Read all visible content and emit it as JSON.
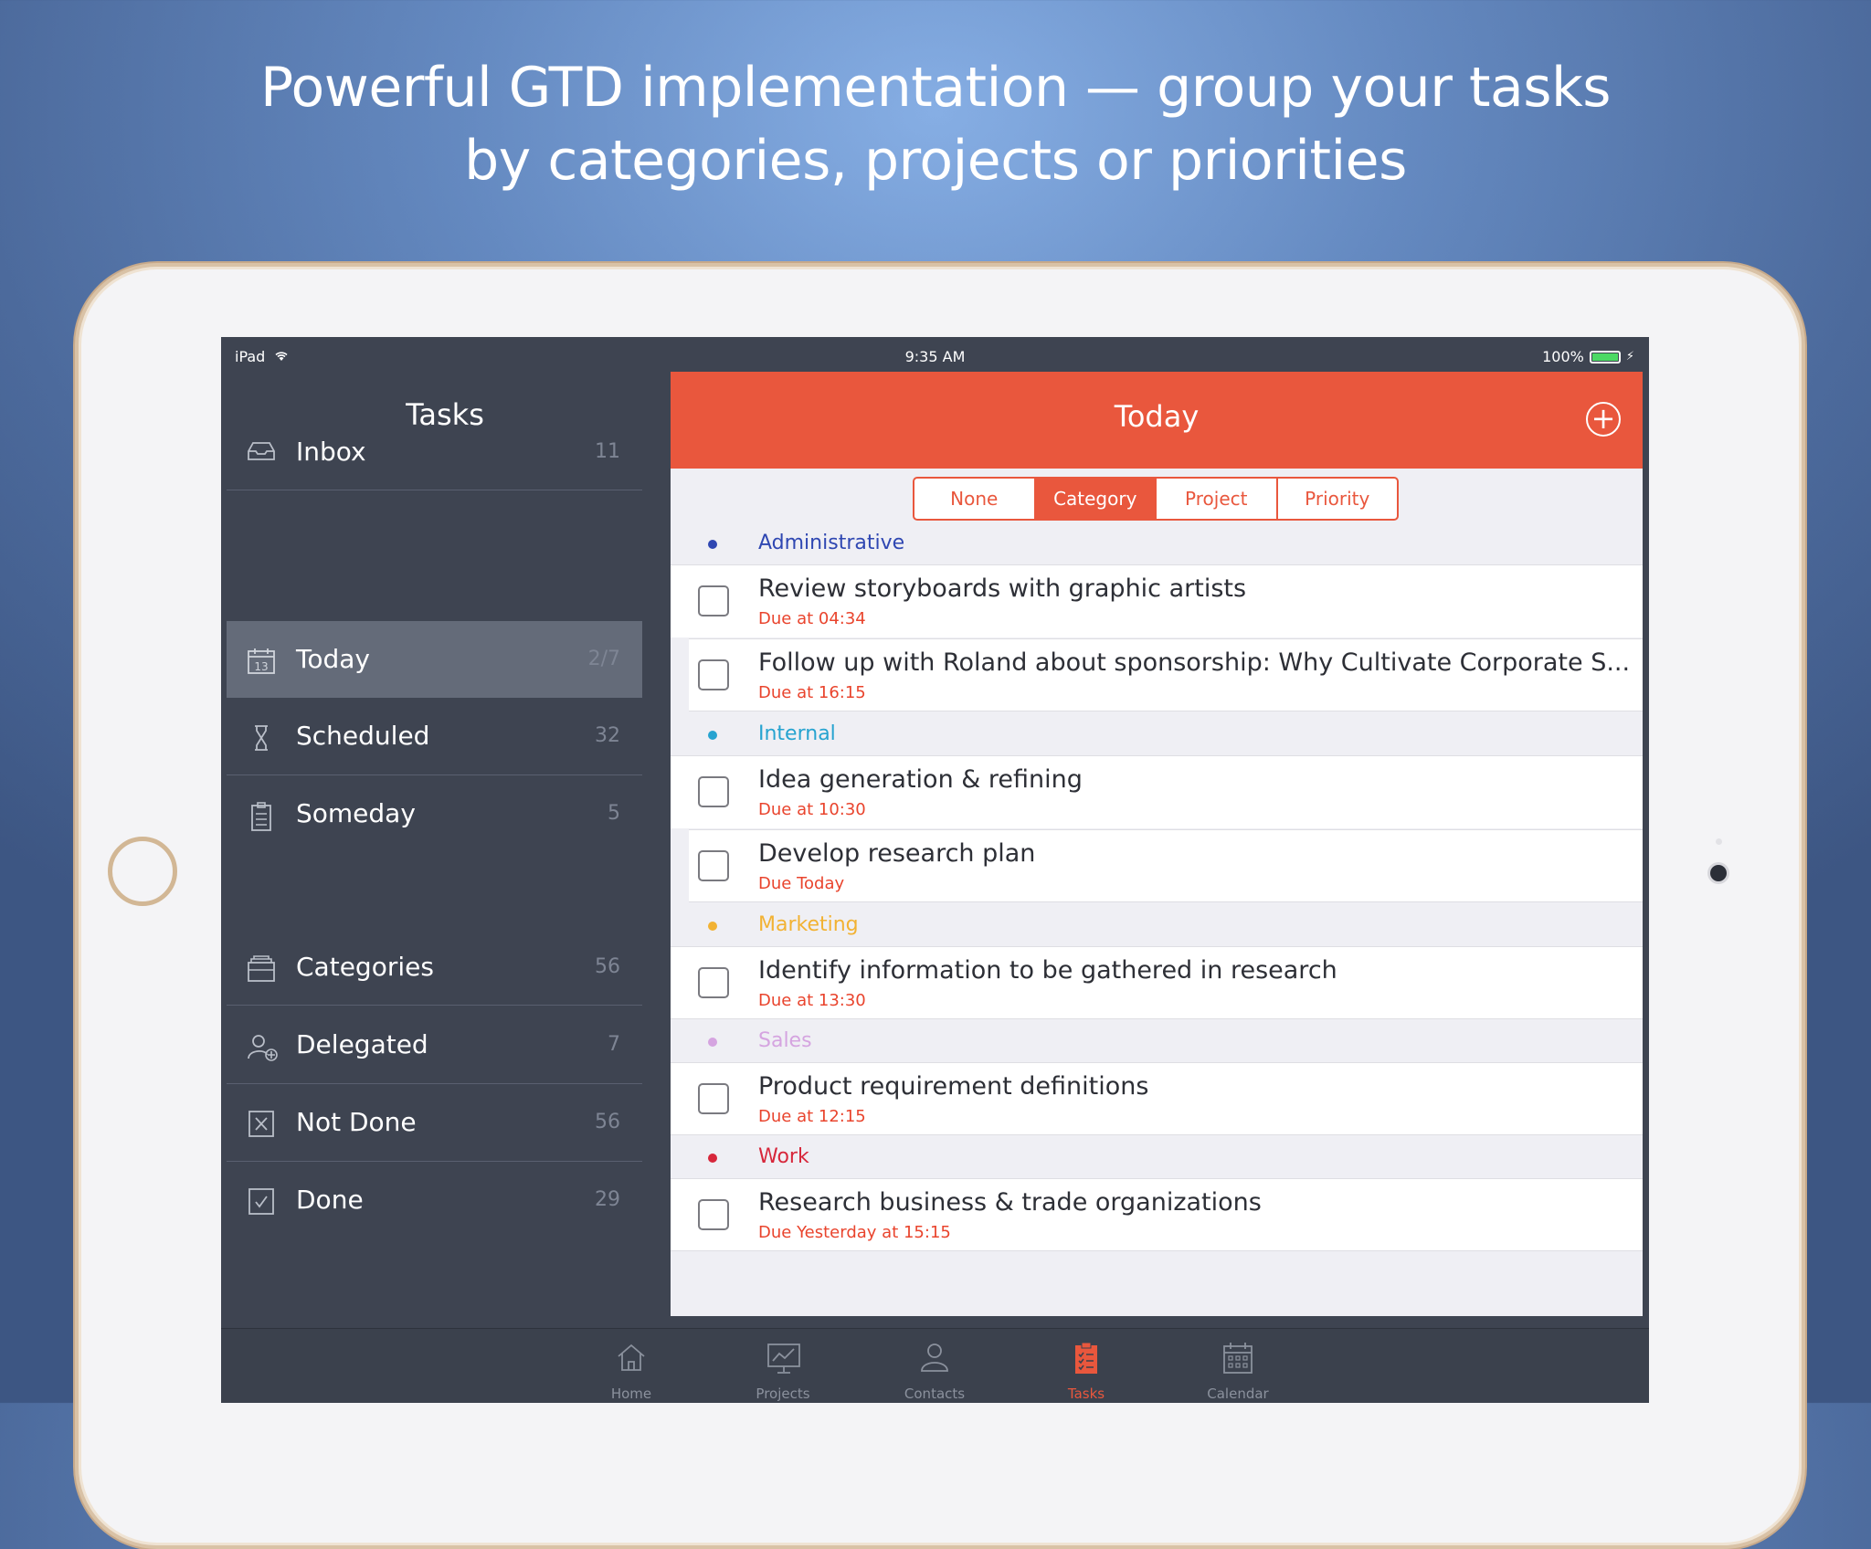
{
  "headline": {
    "line1": "Powerful GTD implementation — group your tasks",
    "line2": "by categories, projects or priorities"
  },
  "status_bar": {
    "device": "iPad",
    "time": "9:35 AM",
    "battery": "100%"
  },
  "sidebar": {
    "title": "Tasks",
    "items": [
      {
        "label": "Inbox",
        "count": "11",
        "icon": "inbox-icon"
      },
      {
        "label": "Today",
        "count": "2/7",
        "icon": "calendar-today-icon",
        "icon_text": "13"
      },
      {
        "label": "Scheduled",
        "count": "32",
        "icon": "hourglass-icon"
      },
      {
        "label": "Someday",
        "count": "5",
        "icon": "clipboard-icon"
      },
      {
        "label": "Categories",
        "count": "56",
        "icon": "categories-icon"
      },
      {
        "label": "Delegated",
        "count": "7",
        "icon": "add-person-icon"
      },
      {
        "label": "Not Done",
        "count": "56",
        "icon": "cross-box-icon"
      },
      {
        "label": "Done",
        "count": "29",
        "icon": "check-box-icon"
      }
    ]
  },
  "main": {
    "title": "Today",
    "add_icon": "plus-circle-icon",
    "segments": [
      "None",
      "Category",
      "Project",
      "Priority"
    ],
    "selected_segment": "Category",
    "groups": [
      {
        "name": "Administrative",
        "color": "#2f47b2",
        "tasks": [
          {
            "title": "Review storyboards with graphic artists",
            "due": "Due at 04:34"
          },
          {
            "title": "Follow up with Roland about sponsorship: Why Cultivate Corporate S...",
            "due": "Due at 16:15"
          }
        ]
      },
      {
        "name": "Internal",
        "color": "#26a3d0",
        "tasks": [
          {
            "title": "Idea generation & refining",
            "due": "Due at 10:30"
          },
          {
            "title": "Develop research plan",
            "due": "Due Today"
          }
        ]
      },
      {
        "name": "Marketing",
        "color": "#f2b233",
        "tasks": [
          {
            "title": "Identify information to be gathered in research",
            "due": "Due at 13:30"
          }
        ]
      },
      {
        "name": "Sales",
        "color": "#d5a4e0",
        "tasks": [
          {
            "title": "Product requirement definitions",
            "due": "Due at 12:15"
          }
        ]
      },
      {
        "name": "Work",
        "color": "#d7273b",
        "tasks": [
          {
            "title": "Research business & trade organizations",
            "due": "Due Yesterday at 15:15"
          }
        ]
      }
    ]
  },
  "tabbar": {
    "tabs": [
      {
        "label": "Home",
        "icon": "home-icon"
      },
      {
        "label": "Projects",
        "icon": "chart-board-icon"
      },
      {
        "label": "Contacts",
        "icon": "person-icon"
      },
      {
        "label": "Tasks",
        "icon": "tasks-clipboard-icon"
      },
      {
        "label": "Calendar",
        "icon": "calendar-grid-icon"
      }
    ],
    "active_tab": "Tasks"
  },
  "colors": {
    "accent": "#e9573d",
    "sidebar_bg": "#3e4451",
    "active_item_bg": "#646b79"
  }
}
